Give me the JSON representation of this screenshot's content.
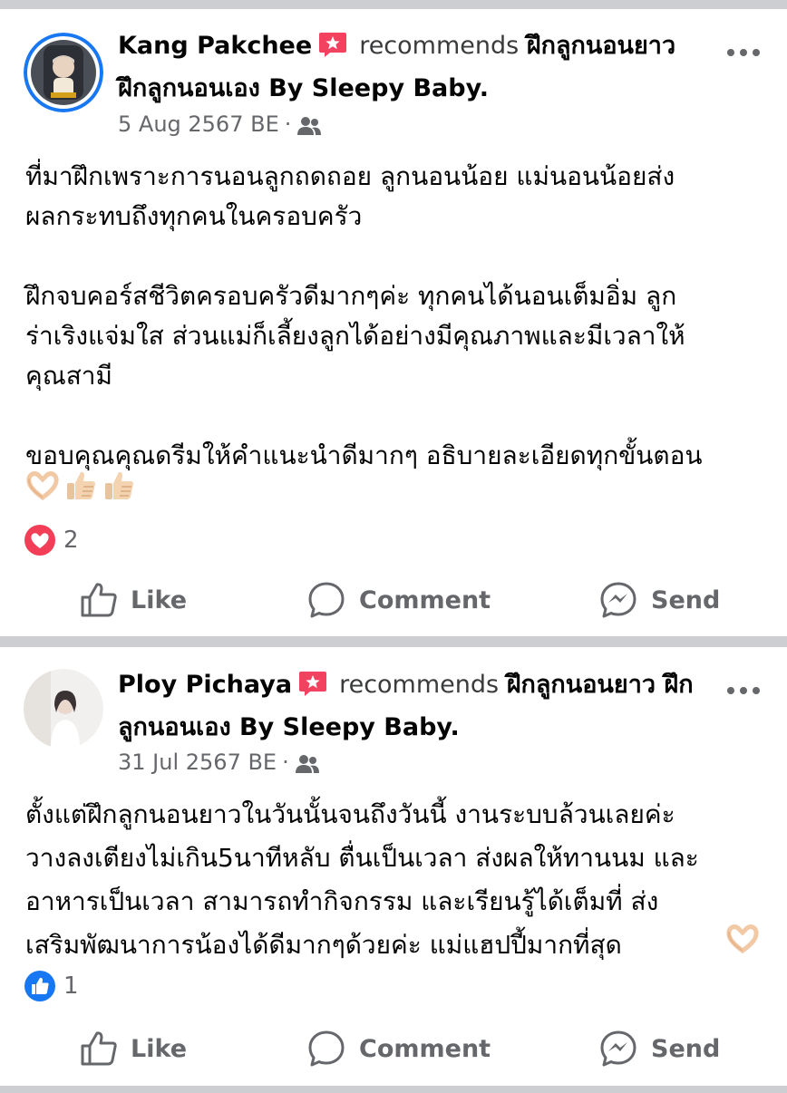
{
  "posts": [
    {
      "author": "Kang Pakchee",
      "verb": "recommends",
      "page_name": "ฝึกลูกนอนยาว ฝึกลูกนอนเอง By Sleepy Baby.",
      "date": "5 Aug 2567 BE",
      "audience_icon": "friends-icon",
      "paragraphs": [
        "ที่มาฝึกเพราะการนอนลูกถดถอย ลูกนอนน้อย แม่นอนน้อยส่ง\nผลกระทบถึงทุกคนในครอบครัว",
        "ฝึกจบคอร์สชีวิตครอบครัวดีมากๆค่ะ ทุกคนได้นอนเต็มอิ่ม ลูก\nร่าเริงแจ่มใส ส่วนแม่ก็เลี้ยงลูกได้อย่างมีคุณภาพและมีเวลาให้\nคุณสามี",
        "ขอบคุณคุณดรีมให้คำแนะนำดีมากๆ อธิบายละเอียดทุกขั้นตอน"
      ],
      "emojis": [
        "heart-hands-emoji",
        "thumbs-up-emoji",
        "thumbs-up-emoji"
      ],
      "reaction_type": "love",
      "reaction_count": "2"
    },
    {
      "author": "Ploy Pichaya",
      "verb": "recommends",
      "page_name": "ฝึกลูกนอนยาว ฝึกลูกนอนเอง By Sleepy Baby.",
      "date": "31 Jul 2567 BE",
      "audience_icon": "friends-icon",
      "paragraphs": [
        "ตั้งแต่ฝึกลูกนอนยาวในวันนั้นจนถึงวันนี้ งานระบบล้วนเลยค่ะ\nวางลงเตียงไม่เกิน5นาทีหลับ ตื่นเป็นเวลา ส่งผลให้ทานนม และ\nอาหารเป็นเวลา สามารถทำกิจกรรม และเรียนรู้ได้เต็มที่ ส่ง\nเสริมพัฒนาการน้องได้ดีมากๆด้วยค่ะ แม่แฮปปี้มากที่สุด"
      ],
      "emojis": [
        "heart-hands-emoji"
      ],
      "reaction_type": "like",
      "reaction_count": "1"
    }
  ],
  "actions": {
    "like": "Like",
    "comment": "Comment",
    "send": "Send"
  },
  "colors": {
    "text": "#050505",
    "secondary": "#65676b",
    "separator": "#ccced2",
    "recommend_badge": "#f3425f",
    "love": "#f33e58",
    "like": "#1877f2",
    "avatar_ring": "#1877f2"
  }
}
